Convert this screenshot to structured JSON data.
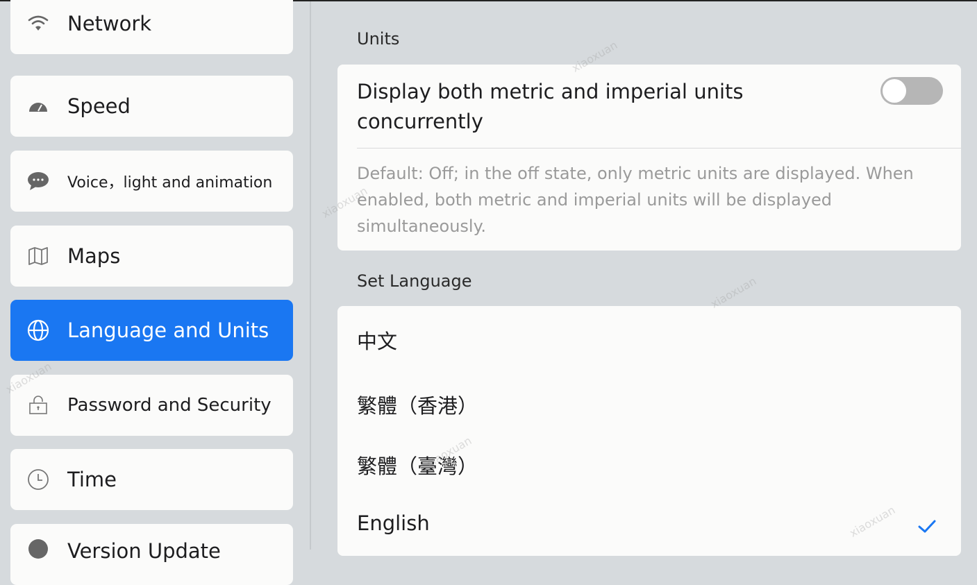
{
  "sidebar": {
    "items": [
      {
        "label": "Network",
        "icon": "wifi-icon"
      },
      {
        "label": "Speed",
        "icon": "speedometer-icon"
      },
      {
        "label": "Voice，light and animation",
        "icon": "chat-bubble-icon"
      },
      {
        "label": "Maps",
        "icon": "map-icon"
      },
      {
        "label": "Language and Units",
        "icon": "globe-icon",
        "active": true
      },
      {
        "label": "Password and Security",
        "icon": "lock-icon"
      },
      {
        "label": "Time",
        "icon": "clock-icon"
      },
      {
        "label": "Version Update",
        "icon": "update-icon"
      }
    ]
  },
  "units": {
    "section_title": "Units",
    "setting_title": "Display both metric and imperial units concurrently",
    "toggle_on": false,
    "description": "Default: Off; in the off state, only metric units are displayed. When enabled, both metric and imperial units will be displayed simultaneously."
  },
  "language": {
    "section_title": "Set Language",
    "options": [
      "中文",
      "繁體（香港）",
      "繁體（臺灣）",
      "English"
    ],
    "selected": "English"
  },
  "watermark": "xiaoxuan",
  "colors": {
    "accent": "#1a77f2",
    "background": "#d6dadd",
    "card": "#fbfbfa"
  }
}
